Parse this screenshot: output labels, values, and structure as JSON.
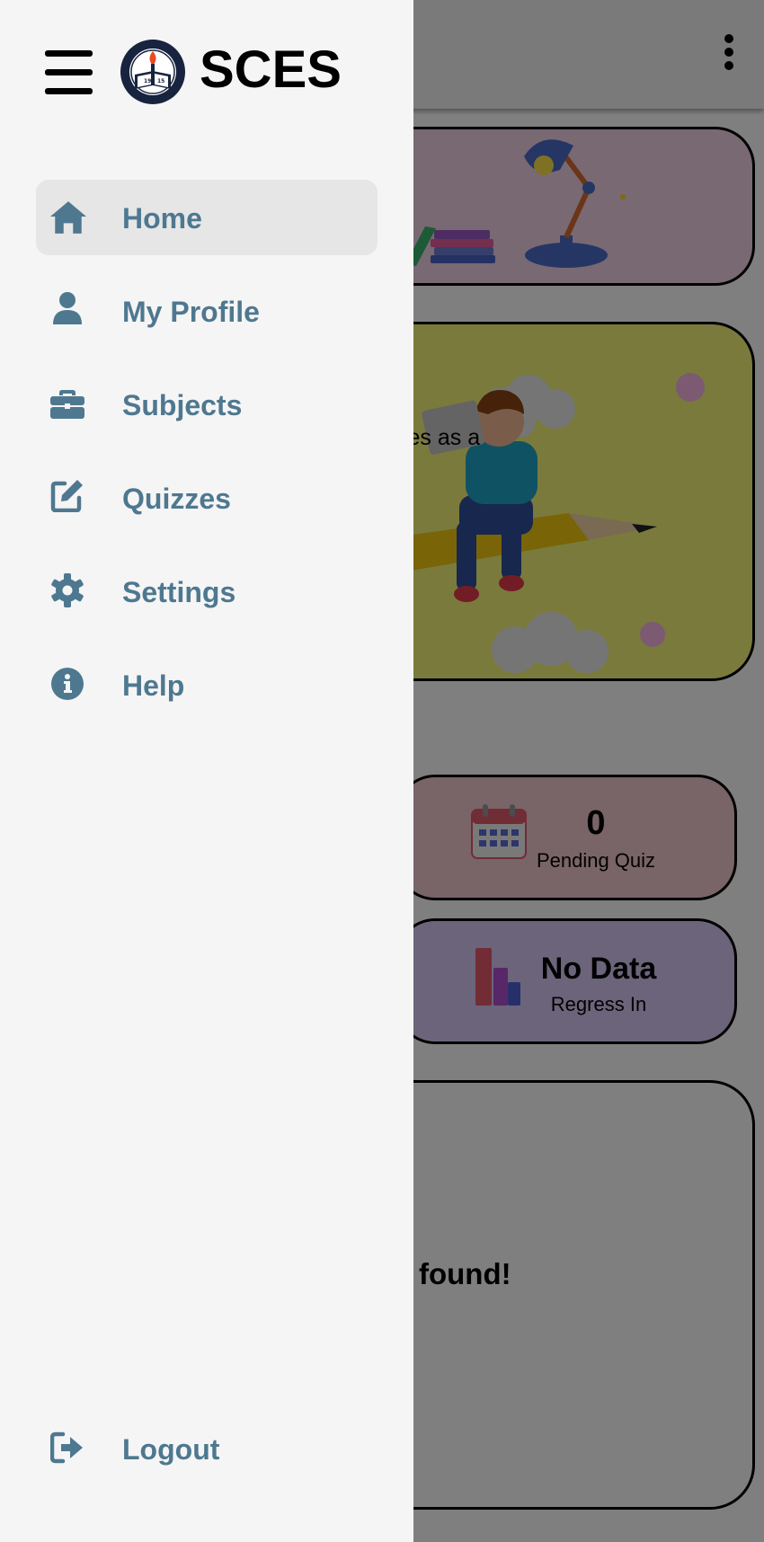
{
  "app": {
    "brand": "SCES",
    "logo_alt": "Sta. Clara Elementary School seal",
    "logo_text_top": "STA. CLARA ELEMENTARY SCHOOL",
    "logo_text_bottom": "BATANGAS CITY",
    "logo_year": "1915"
  },
  "topbar": {
    "more_icon": "more-vertical-icon"
  },
  "drawer": {
    "menu_icon": "hamburger-icon",
    "items": [
      {
        "label": "Home",
        "icon": "home-icon",
        "active": true
      },
      {
        "label": "My Profile",
        "icon": "user-icon",
        "active": false
      },
      {
        "label": "Subjects",
        "icon": "briefcase-icon",
        "active": false
      },
      {
        "label": "Quizzes",
        "icon": "edit-icon",
        "active": false
      },
      {
        "label": "Settings",
        "icon": "gear-icon",
        "active": false
      },
      {
        "label": "Help",
        "icon": "info-icon",
        "active": false
      }
    ],
    "logout": {
      "label": "Logout",
      "icon": "logout-icon"
    }
  },
  "main": {
    "hero_text": "ves as a",
    "stats": {
      "pending": {
        "value": "0",
        "label": "Pending Quiz",
        "icon": "calendar-icon"
      },
      "regress": {
        "value": "No Data",
        "label": "Regress In",
        "icon": "bar-chart-icon"
      }
    },
    "quiz_empty": "uiz found!"
  },
  "colors": {
    "drawer_bg": "#f5f5f5",
    "nav_text": "#4e7890",
    "active_bg": "#e6e6e6",
    "overlay": "rgba(0,0,0,0.5)"
  }
}
